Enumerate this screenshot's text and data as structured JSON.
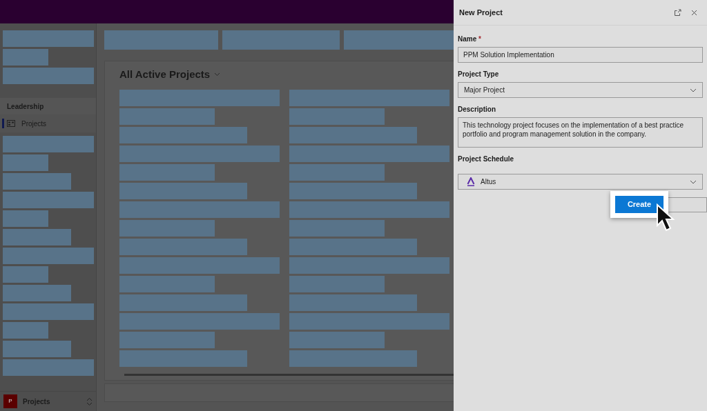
{
  "sidebar": {
    "section_heading": "Leadership",
    "items": [
      {
        "label": "Projects",
        "selected": true
      }
    ],
    "app_switcher": {
      "badge": "P",
      "label": "Projects"
    }
  },
  "main": {
    "view_title": "All Active Projects"
  },
  "panel": {
    "title": "New Project",
    "fields": [
      {
        "kind": "text",
        "label": "Name",
        "required_mark": "*",
        "value": "PPM Solution Implementation"
      },
      {
        "kind": "select",
        "label": "Project Type",
        "value": "Major Project"
      },
      {
        "kind": "textarea",
        "label": "Description",
        "value": "This technology project focuses on the implementation of a best practice portfolio and program management solution in the company."
      },
      {
        "kind": "select",
        "label": "Project Schedule",
        "value": "Altus",
        "logo": true
      }
    ],
    "primary_button": "Create"
  }
}
